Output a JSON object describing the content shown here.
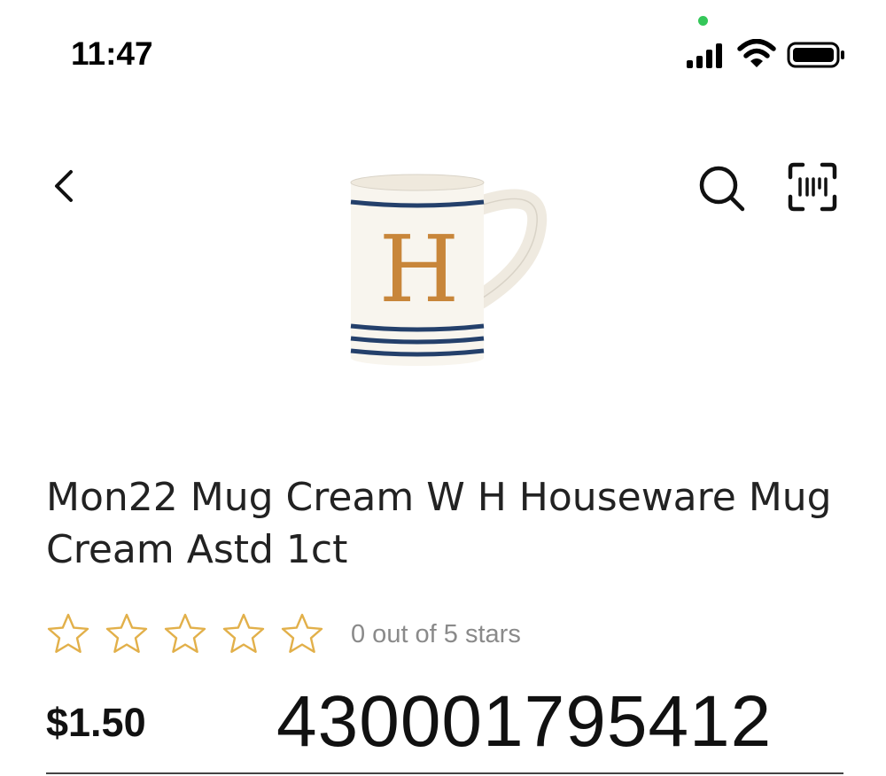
{
  "status_bar": {
    "time": "11:47",
    "icons": [
      "mic-indicator-dot",
      "cellular-signal-icon",
      "wifi-icon",
      "battery-icon"
    ],
    "mic_dot_color": "#34c759"
  },
  "nav": {
    "back_icon": "chevron-left-icon",
    "search_icon": "search-icon",
    "scan_icon": "barcode-scan-icon"
  },
  "product": {
    "image": "mug-image",
    "mug_letter": "H",
    "title": "Mon22 Mug Cream W H Houseware Mug Cream Astd 1ct",
    "rating": {
      "value": 0,
      "max": 5,
      "text": "0 out of 5 stars",
      "star_color": "#e2b04a"
    },
    "price": "$1.50",
    "upc": "430001795412"
  },
  "colors": {
    "stripe_navy": "#24406b",
    "letter_gold": "#c8863a",
    "mug_cream": "#f8f5ee"
  }
}
